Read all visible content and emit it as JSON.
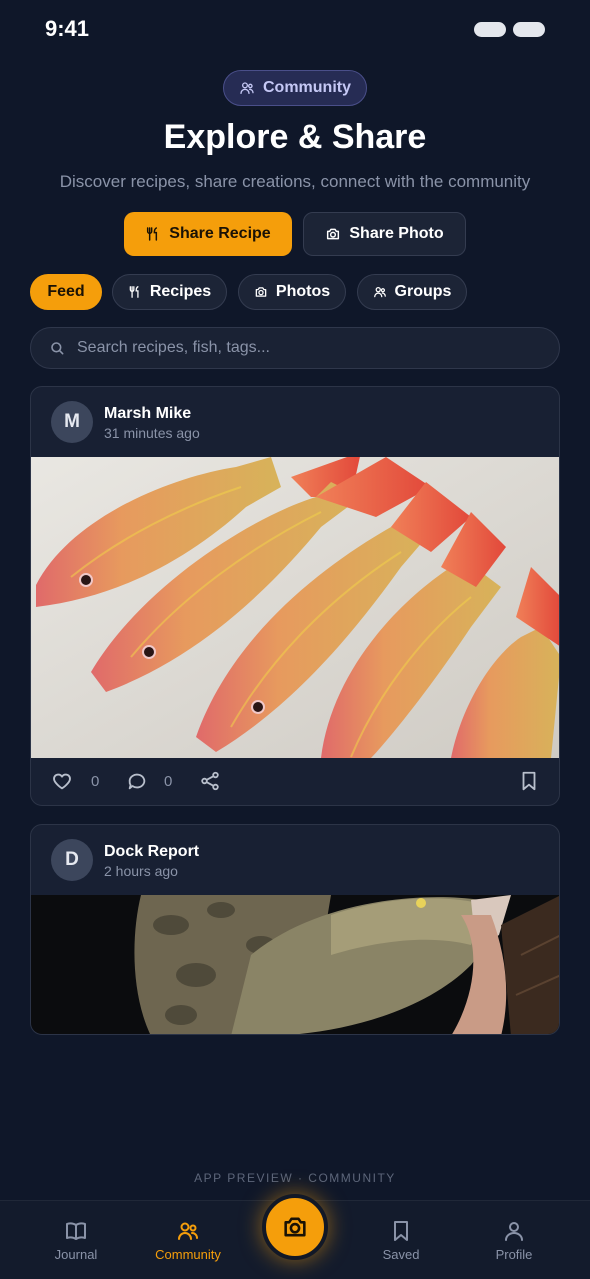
{
  "status_bar": {
    "time": "9:41"
  },
  "header": {
    "badge": {
      "label": "Community",
      "icon": "users-icon"
    },
    "title": "Explore & Share",
    "subtitle": "Discover recipes, share creations, connect with the community"
  },
  "actions": {
    "share_recipe": "Share Recipe",
    "share_photo": "Share Photo"
  },
  "filters": [
    {
      "label": "Feed",
      "active": true
    },
    {
      "label": "Recipes",
      "icon": "utensils-icon"
    },
    {
      "label": "Photos",
      "icon": "camera-icon"
    },
    {
      "label": "Groups",
      "icon": "users-icon"
    }
  ],
  "search": {
    "placeholder": "Search recipes, fish, tags..."
  },
  "posts": [
    {
      "initial": "M",
      "author": "Marsh Mike",
      "time": "31 minutes ago",
      "likes": "0",
      "comments": "0"
    },
    {
      "initial": "D",
      "author": "Dock Report",
      "time": "2 hours ago"
    }
  ],
  "footer_label": "APP PREVIEW · COMMUNITY",
  "tab_bar": {
    "items": [
      {
        "label": "Journal",
        "icon": "book-icon"
      },
      {
        "label": "Community",
        "icon": "users-icon",
        "active": true
      },
      {
        "label": "Saved",
        "icon": "bookmark-icon"
      },
      {
        "label": "Profile",
        "icon": "user-icon"
      }
    ],
    "center_icon": "camera-icon"
  },
  "colors": {
    "accent": "#f59e0b",
    "background": "#0f1729",
    "card": "#182033"
  }
}
